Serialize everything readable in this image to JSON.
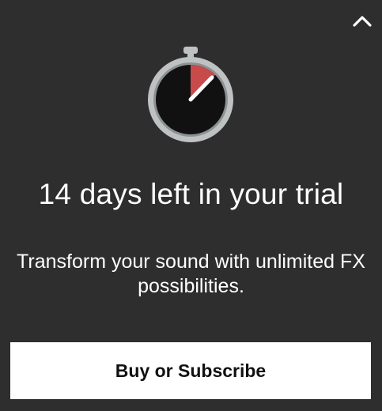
{
  "header": {
    "collapse_icon": "chevron-up-icon"
  },
  "hero": {
    "icon": "stopwatch-icon",
    "icon_colors": {
      "ring": "#bfc2c3",
      "face": "#111111",
      "elapsed": "#c94a4a",
      "hand": "#ffffff"
    }
  },
  "trial": {
    "headline": "14 days left in your trial",
    "description": "Transform your sound with unlimited FX possibilities."
  },
  "cta": {
    "label": "Buy or Subscribe"
  },
  "colors": {
    "background": "#2e2e2e",
    "text": "#ffffff",
    "button_bg": "#ffffff",
    "button_text": "#111111"
  }
}
